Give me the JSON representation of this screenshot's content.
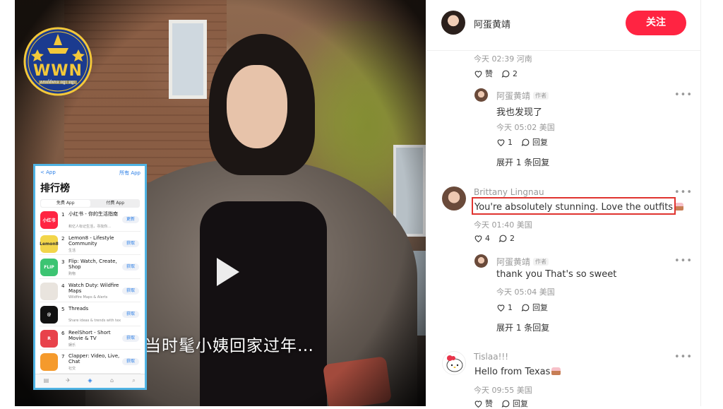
{
  "video": {
    "subtitle": "当时髦小姨回家过年…",
    "logo_text": "WWN",
    "logo_tagline": "សារព័ត៌មាន ឈ្នះ ឈ្នះ"
  },
  "app_store": {
    "back_label": "< App",
    "all_apps_label": "所有 App",
    "title": "排行榜",
    "segments": [
      "免费 App",
      "付费 App"
    ],
    "apps": [
      {
        "rank": "1",
        "name": "小红书 - 你的生活指南",
        "sub": "和亿人标记生活，寻找你…",
        "button": "更新",
        "icon_text": "小红书",
        "icon_color": "#ff2442"
      },
      {
        "rank": "2",
        "name": "Lemon8 - Lifestyle Community",
        "sub": "生活",
        "button": "获取",
        "icon_text": "Lemon8",
        "icon_color": "#f2d54a"
      },
      {
        "rank": "3",
        "name": "Flip: Watch, Create, Shop",
        "sub": "购物",
        "button": "获取",
        "icon_text": "FLIP",
        "icon_color": "#3cc472"
      },
      {
        "rank": "4",
        "name": "Watch Duty: Wildfire Maps",
        "sub": "Wildfire Maps & Alerts",
        "button": "获取",
        "icon_text": "",
        "icon_color": "#e9e4de"
      },
      {
        "rank": "5",
        "name": "Threads",
        "sub": "Share ideas & trends with text",
        "button": "获取",
        "icon_text": "@",
        "icon_color": "#111111"
      },
      {
        "rank": "6",
        "name": "ReelShort - Short Movie & TV",
        "sub": "娱乐",
        "button": "获取",
        "icon_text": "R",
        "icon_color": "#e8424b"
      },
      {
        "rank": "7",
        "name": "Clapper: Video, Live, Chat",
        "sub": "社交",
        "button": "获取",
        "icon_text": "",
        "icon_color": "#f59a2c"
      }
    ]
  },
  "panel": {
    "author_name": "阿蛋黄靖",
    "follow_label": "关注",
    "comments": [
      {
        "meta": "今天 02:39 河南",
        "likes": "赞",
        "replies": "2"
      },
      {
        "name": "阿蛋黄靖",
        "tag": "作者",
        "text": "我也发现了",
        "meta": "今天 05:02 美国",
        "likes": "1",
        "replies": "回复",
        "expand": "展开 1 条回复"
      },
      {
        "name": "Brittany Lingnau",
        "text": "You're absolutely stunning. Love the outfits",
        "meta": "今天 01:40 美国",
        "likes": "4",
        "replies": "2"
      },
      {
        "name": "阿蛋黄靖",
        "tag": "作者",
        "text": "thank you That's so sweet",
        "meta": "今天 05:04 美国",
        "likes": "1",
        "replies": "回复",
        "expand": "展开 1 条回复"
      },
      {
        "name": "Tislaa!!!",
        "text": "Hello from Texas",
        "meta": "今天 09:55 美国",
        "likes": "赞",
        "replies": "回复"
      }
    ]
  },
  "colors": {
    "follow_bg": "#ff2442",
    "highlight_border": "#e0342f",
    "inset_border": "#4fb3e3"
  }
}
